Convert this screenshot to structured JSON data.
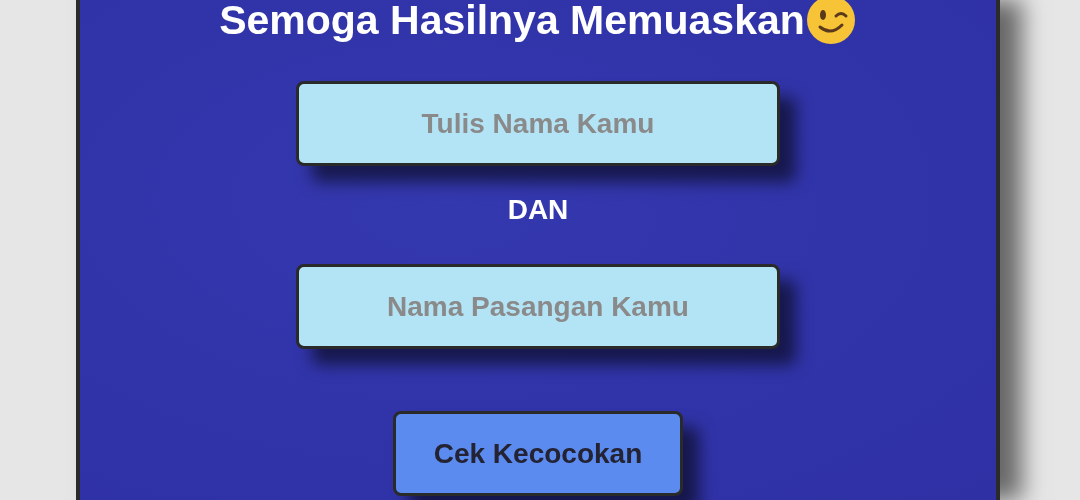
{
  "title": "Semoga Hasilnya Memuaskan",
  "fields": [
    {
      "placeholder": "Tulis Nama Kamu"
    },
    {
      "placeholder": "Nama Pasangan Kamu"
    }
  ],
  "separator": "DAN",
  "button": {
    "label": "Cek Kecocokan"
  }
}
